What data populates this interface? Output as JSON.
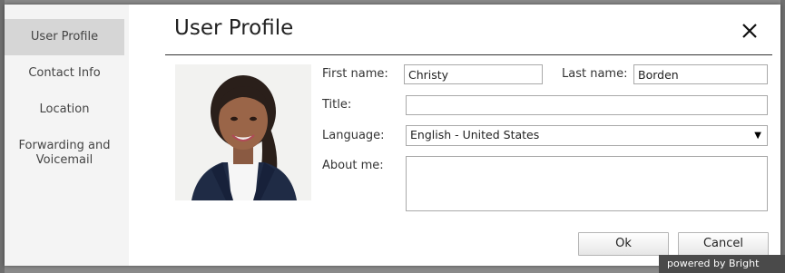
{
  "sidebar": {
    "items": [
      {
        "label": "User Profile",
        "active": true
      },
      {
        "label": "Contact Info"
      },
      {
        "label": "Location"
      },
      {
        "label": "Forwarding and Voicemail"
      }
    ]
  },
  "dialog": {
    "title": "User Profile",
    "close_icon": "close-icon"
  },
  "form": {
    "first_name_label": "First name:",
    "first_name_value": "Christy",
    "last_name_label": "Last name:",
    "last_name_value": "Borden",
    "title_label": "Title:",
    "title_value": "",
    "language_label": "Language:",
    "language_value": "English - United States",
    "about_label": "About me:",
    "about_value": ""
  },
  "buttons": {
    "ok": "Ok",
    "cancel": "Cancel"
  },
  "footer": {
    "powered_by": "powered by Bright Pattern"
  }
}
